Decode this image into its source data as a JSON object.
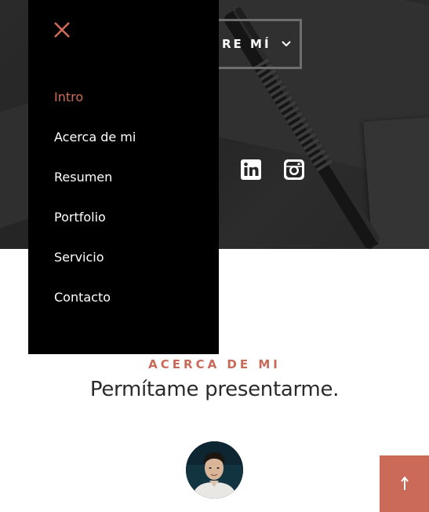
{
  "hero": {
    "about_button_label": "RE MÍ",
    "chevron_icon": "chevron-down-icon",
    "social": [
      "linkedin-icon",
      "instagram-icon"
    ]
  },
  "menu": {
    "close_icon": "close-icon",
    "items": [
      {
        "label": "Intro",
        "active": true
      },
      {
        "label": "Acerca de mi",
        "active": false
      },
      {
        "label": "Resumen",
        "active": false
      },
      {
        "label": "Portfolio",
        "active": false
      },
      {
        "label": "Servicio",
        "active": false
      },
      {
        "label": "Contacto",
        "active": false
      }
    ]
  },
  "about": {
    "kicker": "ACERCA DE MI",
    "headline": "Permítame presentarme."
  },
  "back_to_top": {
    "icon": "arrow-up-icon"
  },
  "colors": {
    "accent": "#cc6a5a",
    "menu_bg": "#000000",
    "hero_bg": "#282828",
    "headline": "#2b2b2b"
  }
}
